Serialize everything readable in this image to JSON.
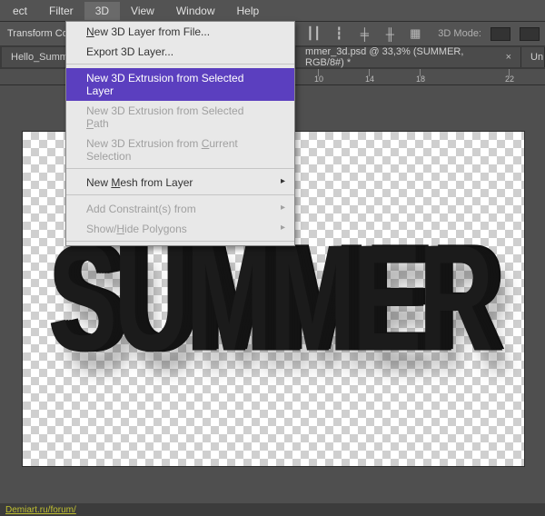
{
  "menubar": {
    "items": [
      "ect",
      "Filter",
      "3D",
      "View",
      "Window",
      "Help"
    ],
    "active_index": 2
  },
  "optbar": {
    "left_label": "Transform Con",
    "mode_label": "3D Mode:"
  },
  "tabs": {
    "left_fragment": "Hello_Summ",
    "right_fragment": "mmer_3d.psd @ 33,3% (SUMMER, RGB/8#) *",
    "far_right_fragment": "Un"
  },
  "ruler": {
    "ticks": [
      {
        "pos": 350,
        "label": "10"
      },
      {
        "pos": 406,
        "label": "14"
      },
      {
        "pos": 462,
        "label": "18"
      },
      {
        "pos": 560,
        "label": "22"
      }
    ]
  },
  "menu": {
    "items": [
      {
        "label": "New 3D Layer from File...",
        "mnemonic": "N",
        "enabled": true
      },
      {
        "label": "Export 3D Layer...",
        "enabled": true,
        "sep_after": true
      },
      {
        "label": "New 3D Extrusion from Selected Layer",
        "enabled": true,
        "highlight": true
      },
      {
        "label": "New 3D Extrusion from Selected Path",
        "mnemonic": "P",
        "enabled": false
      },
      {
        "label": "New 3D Extrusion from Current Selection",
        "mnemonic": "C",
        "enabled": false,
        "sep_after": true
      },
      {
        "label": "New Mesh from Layer",
        "mnemonic": "M",
        "enabled": true,
        "submenu": true,
        "sep_after": true
      },
      {
        "label": "Add Constraint(s) from",
        "enabled": false,
        "submenu": true
      },
      {
        "label": "Show/Hide Polygons",
        "mnemonic": "H",
        "enabled": false,
        "submenu": true,
        "sep_after": true
      }
    ]
  },
  "canvas": {
    "text": "SUMMER"
  },
  "footer": {
    "link": "Demiart.ru/forum/"
  }
}
